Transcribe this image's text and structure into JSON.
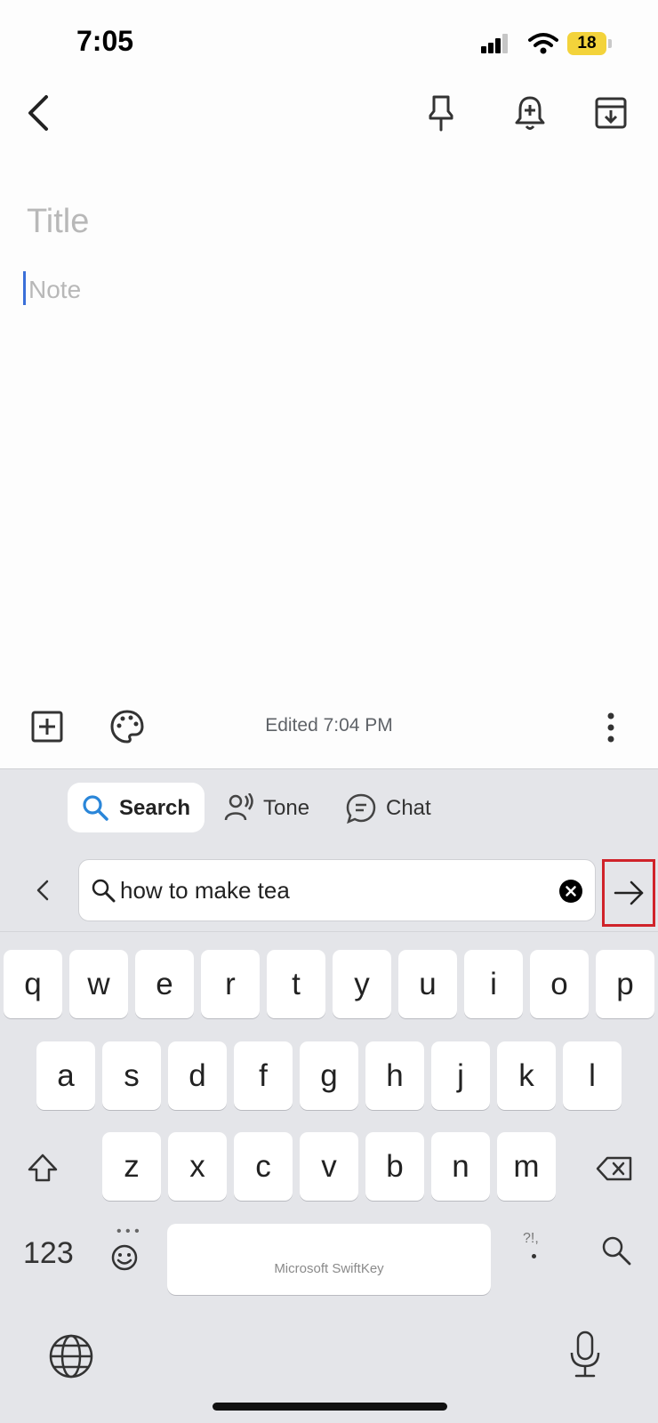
{
  "status_bar": {
    "time": "7:05",
    "battery": "18"
  },
  "note": {
    "title_placeholder": "Title",
    "body_placeholder": "Note"
  },
  "bottom_bar": {
    "edited_text": "Edited 7:04 PM"
  },
  "keyboard": {
    "tabs": [
      {
        "label": "Search",
        "icon": "search-icon",
        "active": true
      },
      {
        "label": "Tone",
        "icon": "tone-icon",
        "active": false
      },
      {
        "label": "Chat",
        "icon": "chat-icon",
        "active": false
      }
    ],
    "search_query": "how to make tea",
    "rows": [
      [
        "q",
        "w",
        "e",
        "r",
        "t",
        "y",
        "u",
        "i",
        "o",
        "p"
      ],
      [
        "a",
        "s",
        "d",
        "f",
        "g",
        "h",
        "j",
        "k",
        "l"
      ],
      [
        "z",
        "x",
        "c",
        "v",
        "b",
        "n",
        "m"
      ]
    ],
    "numbers_label": "123",
    "space_label": "Microsoft SwiftKey",
    "punctuation_label": "?!,"
  },
  "colors": {
    "accent": "#3a6fd8",
    "highlight": "#d0232a",
    "battery": "#f3d33b"
  }
}
